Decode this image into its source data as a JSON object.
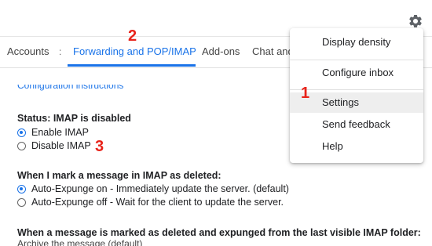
{
  "header": {
    "settings_icon": "gear-icon"
  },
  "tabs": [
    {
      "label": "Accounts",
      "active": false
    },
    {
      "label": "Forwarding and POP/IMAP",
      "active": true
    },
    {
      "label": "Add-ons",
      "active": false
    },
    {
      "label": "Chat and",
      "active": false
    }
  ],
  "tab_separator": ":",
  "annotations": {
    "one": "1",
    "two": "2",
    "three": "3",
    "color": "#e8231a"
  },
  "config_link": "Configuration instructions",
  "imap": {
    "status_title": "Status: IMAP is disabled",
    "enable_label": "Enable IMAP",
    "disable_label": "Disable IMAP",
    "selected": "enable"
  },
  "deleted": {
    "title": "When I mark a message in IMAP as deleted:",
    "on_label": "Auto-Expunge on - Immediately update the server. (default)",
    "off_label": "Auto-Expunge off - Wait for the client to update the server.",
    "selected": "on"
  },
  "expunged": {
    "title": "When a message is marked as deleted and expunged from the last visible IMAP folder:",
    "archive_label": "Archive the message (default)"
  },
  "menu": {
    "items": [
      {
        "label": "Display density",
        "highlighted": false
      },
      {
        "label": "Configure inbox",
        "highlighted": false
      },
      {
        "label": "Settings",
        "highlighted": true
      },
      {
        "label": "Send feedback",
        "highlighted": false
      },
      {
        "label": "Help",
        "highlighted": false
      }
    ]
  },
  "colors": {
    "accent": "#1a73e8",
    "highlight_bg": "#eeeeee"
  }
}
